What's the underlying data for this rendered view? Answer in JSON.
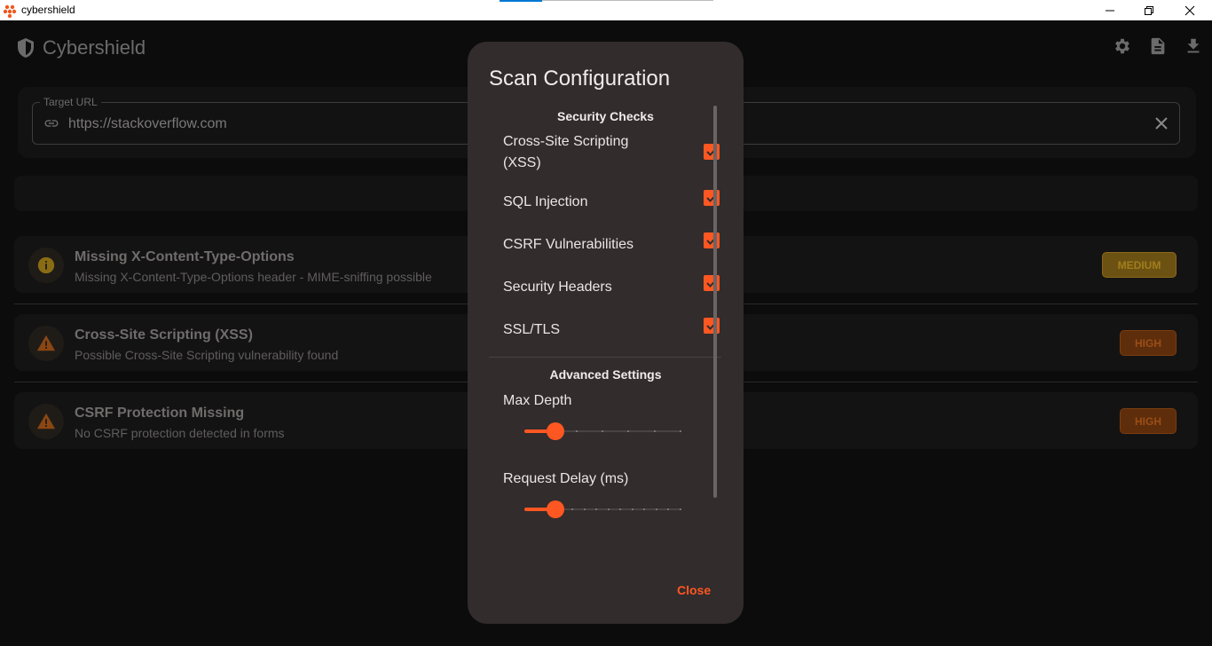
{
  "window": {
    "title": "cybershield",
    "controls": {
      "minimize": "minimize-icon",
      "maximize": "restore-icon",
      "close": "close-icon"
    }
  },
  "header": {
    "app_name": "Cybershield",
    "actions": [
      "gear-icon",
      "document-icon",
      "download-icon"
    ]
  },
  "url_input": {
    "label": "Target URL",
    "value": "https://stackoverflow.com"
  },
  "findings": [
    {
      "title": "Missing X-Content-Type-Options",
      "description": "Missing X-Content-Type-Options header - MIME-sniffing possible",
      "severity": "MEDIUM",
      "icon": "info-icon"
    },
    {
      "title": "Cross-Site Scripting (XSS)",
      "description": "Possible Cross-Site Scripting vulnerability found",
      "severity": "HIGH",
      "icon": "warning-icon"
    },
    {
      "title": "CSRF Protection Missing",
      "description": "No CSRF protection detected in forms",
      "severity": "HIGH",
      "icon": "warning-icon"
    }
  ],
  "dialog": {
    "title": "Scan Configuration",
    "security_checks_heading": "Security Checks",
    "checks": [
      {
        "label": "Cross-Site Scripting (XSS)",
        "checked": true
      },
      {
        "label": "SQL Injection",
        "checked": true
      },
      {
        "label": "CSRF Vulnerabilities",
        "checked": true
      },
      {
        "label": "Security Headers",
        "checked": true
      },
      {
        "label": "SSL/TLS",
        "checked": true
      }
    ],
    "advanced_heading": "Advanced Settings",
    "sliders": [
      {
        "label": "Max Depth",
        "fraction": 0.2
      },
      {
        "label": "Request Delay (ms)",
        "fraction": 0.2
      }
    ],
    "close_label": "Close"
  },
  "colors": {
    "accent": "#ff5722",
    "dialog_bg": "#322c2c",
    "app_bg": "#0d0c0c",
    "medium_badge": "#6b5213",
    "high_badge": "#5e2d0b"
  }
}
